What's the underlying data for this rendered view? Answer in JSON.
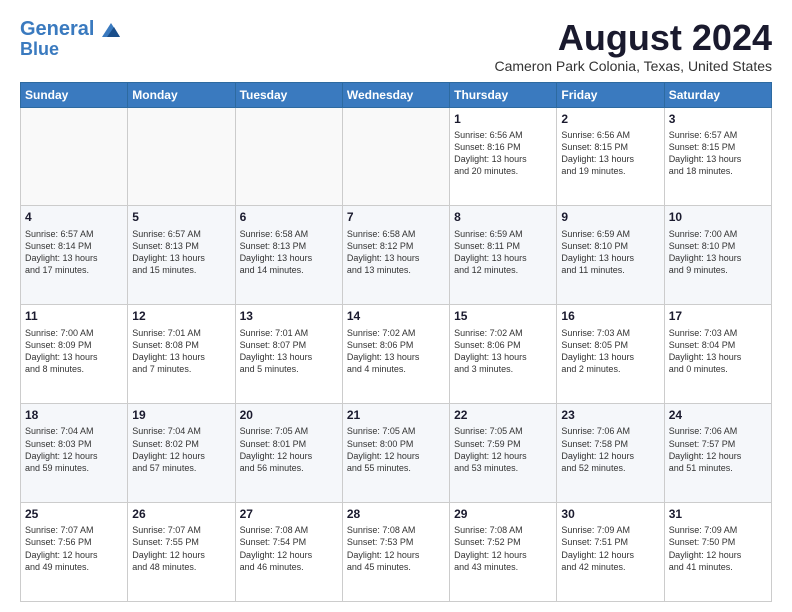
{
  "logo": {
    "line1": "General",
    "line2": "Blue"
  },
  "title": "August 2024",
  "location": "Cameron Park Colonia, Texas, United States",
  "days_of_week": [
    "Sunday",
    "Monday",
    "Tuesday",
    "Wednesday",
    "Thursday",
    "Friday",
    "Saturday"
  ],
  "weeks": [
    [
      {
        "day": "",
        "info": ""
      },
      {
        "day": "",
        "info": ""
      },
      {
        "day": "",
        "info": ""
      },
      {
        "day": "",
        "info": ""
      },
      {
        "day": "1",
        "info": "Sunrise: 6:56 AM\nSunset: 8:16 PM\nDaylight: 13 hours\nand 20 minutes."
      },
      {
        "day": "2",
        "info": "Sunrise: 6:56 AM\nSunset: 8:15 PM\nDaylight: 13 hours\nand 19 minutes."
      },
      {
        "day": "3",
        "info": "Sunrise: 6:57 AM\nSunset: 8:15 PM\nDaylight: 13 hours\nand 18 minutes."
      }
    ],
    [
      {
        "day": "4",
        "info": "Sunrise: 6:57 AM\nSunset: 8:14 PM\nDaylight: 13 hours\nand 17 minutes."
      },
      {
        "day": "5",
        "info": "Sunrise: 6:57 AM\nSunset: 8:13 PM\nDaylight: 13 hours\nand 15 minutes."
      },
      {
        "day": "6",
        "info": "Sunrise: 6:58 AM\nSunset: 8:13 PM\nDaylight: 13 hours\nand 14 minutes."
      },
      {
        "day": "7",
        "info": "Sunrise: 6:58 AM\nSunset: 8:12 PM\nDaylight: 13 hours\nand 13 minutes."
      },
      {
        "day": "8",
        "info": "Sunrise: 6:59 AM\nSunset: 8:11 PM\nDaylight: 13 hours\nand 12 minutes."
      },
      {
        "day": "9",
        "info": "Sunrise: 6:59 AM\nSunset: 8:10 PM\nDaylight: 13 hours\nand 11 minutes."
      },
      {
        "day": "10",
        "info": "Sunrise: 7:00 AM\nSunset: 8:10 PM\nDaylight: 13 hours\nand 9 minutes."
      }
    ],
    [
      {
        "day": "11",
        "info": "Sunrise: 7:00 AM\nSunset: 8:09 PM\nDaylight: 13 hours\nand 8 minutes."
      },
      {
        "day": "12",
        "info": "Sunrise: 7:01 AM\nSunset: 8:08 PM\nDaylight: 13 hours\nand 7 minutes."
      },
      {
        "day": "13",
        "info": "Sunrise: 7:01 AM\nSunset: 8:07 PM\nDaylight: 13 hours\nand 5 minutes."
      },
      {
        "day": "14",
        "info": "Sunrise: 7:02 AM\nSunset: 8:06 PM\nDaylight: 13 hours\nand 4 minutes."
      },
      {
        "day": "15",
        "info": "Sunrise: 7:02 AM\nSunset: 8:06 PM\nDaylight: 13 hours\nand 3 minutes."
      },
      {
        "day": "16",
        "info": "Sunrise: 7:03 AM\nSunset: 8:05 PM\nDaylight: 13 hours\nand 2 minutes."
      },
      {
        "day": "17",
        "info": "Sunrise: 7:03 AM\nSunset: 8:04 PM\nDaylight: 13 hours\nand 0 minutes."
      }
    ],
    [
      {
        "day": "18",
        "info": "Sunrise: 7:04 AM\nSunset: 8:03 PM\nDaylight: 12 hours\nand 59 minutes."
      },
      {
        "day": "19",
        "info": "Sunrise: 7:04 AM\nSunset: 8:02 PM\nDaylight: 12 hours\nand 57 minutes."
      },
      {
        "day": "20",
        "info": "Sunrise: 7:05 AM\nSunset: 8:01 PM\nDaylight: 12 hours\nand 56 minutes."
      },
      {
        "day": "21",
        "info": "Sunrise: 7:05 AM\nSunset: 8:00 PM\nDaylight: 12 hours\nand 55 minutes."
      },
      {
        "day": "22",
        "info": "Sunrise: 7:05 AM\nSunset: 7:59 PM\nDaylight: 12 hours\nand 53 minutes."
      },
      {
        "day": "23",
        "info": "Sunrise: 7:06 AM\nSunset: 7:58 PM\nDaylight: 12 hours\nand 52 minutes."
      },
      {
        "day": "24",
        "info": "Sunrise: 7:06 AM\nSunset: 7:57 PM\nDaylight: 12 hours\nand 51 minutes."
      }
    ],
    [
      {
        "day": "25",
        "info": "Sunrise: 7:07 AM\nSunset: 7:56 PM\nDaylight: 12 hours\nand 49 minutes."
      },
      {
        "day": "26",
        "info": "Sunrise: 7:07 AM\nSunset: 7:55 PM\nDaylight: 12 hours\nand 48 minutes."
      },
      {
        "day": "27",
        "info": "Sunrise: 7:08 AM\nSunset: 7:54 PM\nDaylight: 12 hours\nand 46 minutes."
      },
      {
        "day": "28",
        "info": "Sunrise: 7:08 AM\nSunset: 7:53 PM\nDaylight: 12 hours\nand 45 minutes."
      },
      {
        "day": "29",
        "info": "Sunrise: 7:08 AM\nSunset: 7:52 PM\nDaylight: 12 hours\nand 43 minutes."
      },
      {
        "day": "30",
        "info": "Sunrise: 7:09 AM\nSunset: 7:51 PM\nDaylight: 12 hours\nand 42 minutes."
      },
      {
        "day": "31",
        "info": "Sunrise: 7:09 AM\nSunset: 7:50 PM\nDaylight: 12 hours\nand 41 minutes."
      }
    ]
  ]
}
